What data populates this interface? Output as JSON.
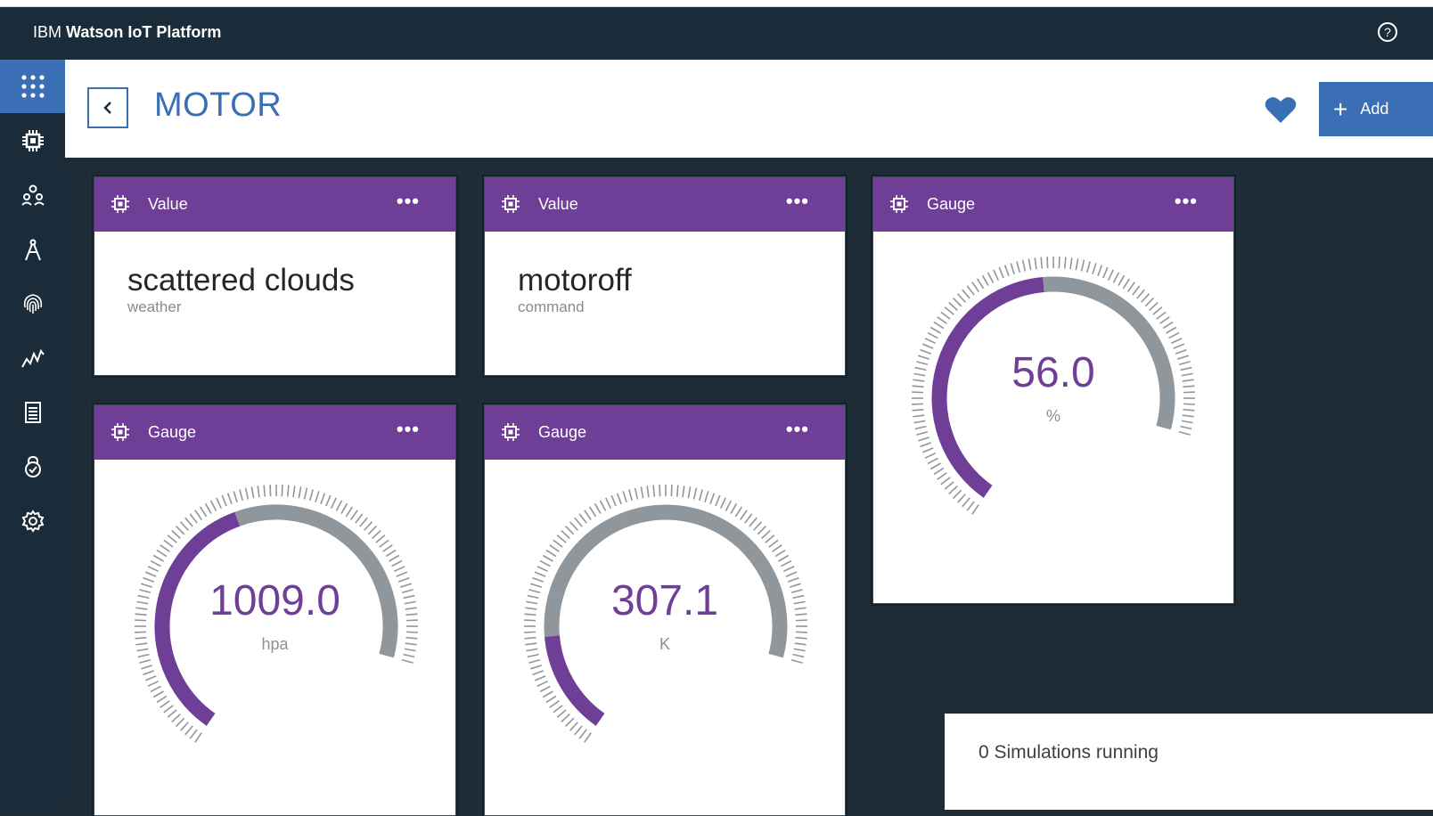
{
  "app": {
    "brand_prefix": "IBM ",
    "brand_name": "Watson IoT Platform",
    "help_label": "?"
  },
  "sidebar": {
    "items": [
      {
        "icon": "apps-grid-icon",
        "active": true
      },
      {
        "icon": "chip-icon"
      },
      {
        "icon": "members-icon"
      },
      {
        "icon": "compass-icon"
      },
      {
        "icon": "fingerprint-icon"
      },
      {
        "icon": "analytics-icon"
      },
      {
        "icon": "log-icon"
      },
      {
        "icon": "security-lock-icon"
      },
      {
        "icon": "settings-gear-icon"
      }
    ]
  },
  "header": {
    "title": "MOTOR",
    "add_label": "Add",
    "favorite": true
  },
  "cards": [
    {
      "type": "Value",
      "value": "scattered clouds",
      "label": "weather"
    },
    {
      "type": "Value",
      "value": "motoroff",
      "label": "command"
    },
    {
      "type": "Gauge",
      "value": "56.0",
      "unit": "%",
      "fraction": 0.56
    },
    {
      "type": "Gauge",
      "value": "1009.0",
      "unit": "hpa",
      "fraction": 0.5
    },
    {
      "type": "Gauge",
      "value": "307.1",
      "unit": "K",
      "fraction": 0.2
    }
  ],
  "more_label": "•••",
  "simulations": {
    "text": "0 Simulations running"
  },
  "colors": {
    "accent": "#3a6eb5",
    "card_header": "#6f3f98",
    "gauge_fill": "#6f3f98",
    "gauge_track": "#8f969c",
    "background": "#1d2c36"
  }
}
